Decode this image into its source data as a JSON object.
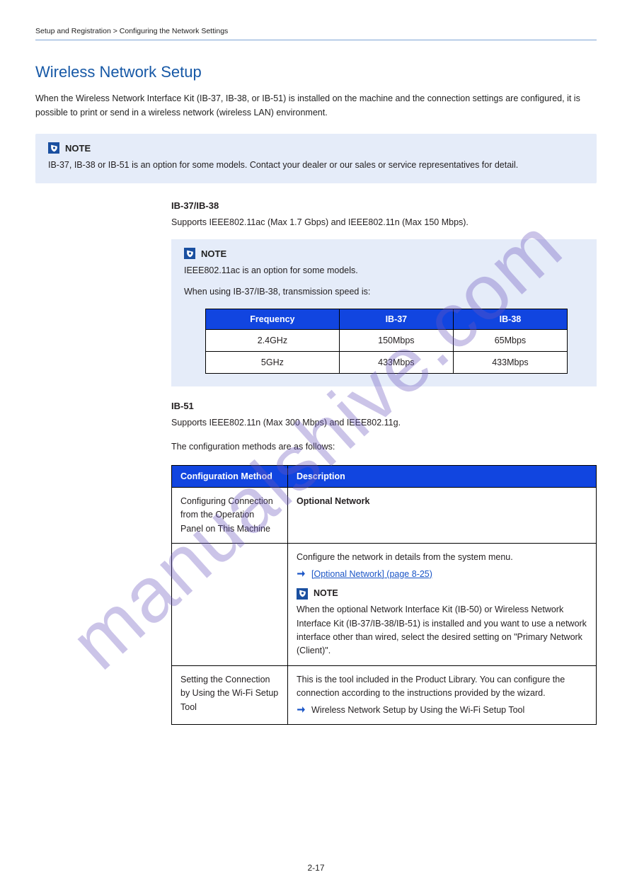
{
  "breadcrumb": "Setup and Registration > Configuring the Network Settings",
  "heading": "Wireless Network Setup",
  "intro": "When the Wireless Network Interface Kit (IB-37, IB-38, or IB-51) is installed on the machine and the connection settings are configured, it is possible to print or send in a wireless network (wireless LAN) environment.",
  "main_note": {
    "title": "NOTE",
    "body": "IB-37, IB-38 or IB-51 is an option for some models. Contact your dealer or our sales or service representatives for detail."
  },
  "term": "IB-37/IB-38",
  "term_desc": "Supports IEEE802.11ac (Max 1.7 Gbps) and IEEE802.11n (Max 150 Mbps).",
  "sub_note": {
    "title": "NOTE",
    "body1": "IEEE802.11ac is an option for some models.",
    "body2": "When using IB-37/IB-38, transmission speed is:"
  },
  "small_table": {
    "headers": [
      "Frequency",
      "IB-37",
      "IB-38"
    ],
    "rows": [
      [
        "2.4GHz",
        "150Mbps",
        "65Mbps"
      ],
      [
        "5GHz",
        "433Mbps",
        "433Mbps"
      ]
    ]
  },
  "ib51_label": "IB-51",
  "ib51_desc": "Supports IEEE802.11n (Max 300 Mbps) and IEEE802.11g.",
  "config_intro": "The configuration methods are as follows:",
  "big_table": {
    "headers": [
      "Configuration Method",
      "Description"
    ],
    "rows": [
      {
        "item": "Configuring Connection from the Operation Panel on This Machine",
        "desc_title": "Optional Network",
        "desc_body": "Configure the network in details from the system menu.",
        "ref_label": "[Optional Network] (page 8-25)",
        "note_title": "NOTE",
        "note_body": "When the optional Network Interface Kit (IB-50) or Wireless Network Interface Kit (IB-37/IB-38/IB-51) is installed and you want to use a network interface other than wired, select the desired setting on \"Primary Network (Client)\"."
      },
      {
        "item": "Setting the Connection by Using the Wi-Fi Setup Tool",
        "desc": "This is the tool included in the Product Library. You can configure the connection according to the instructions provided by the wizard.",
        "ref": "Wireless Network Setup by Using the Wi-Fi Setup Tool"
      }
    ]
  },
  "footer": "2-17"
}
